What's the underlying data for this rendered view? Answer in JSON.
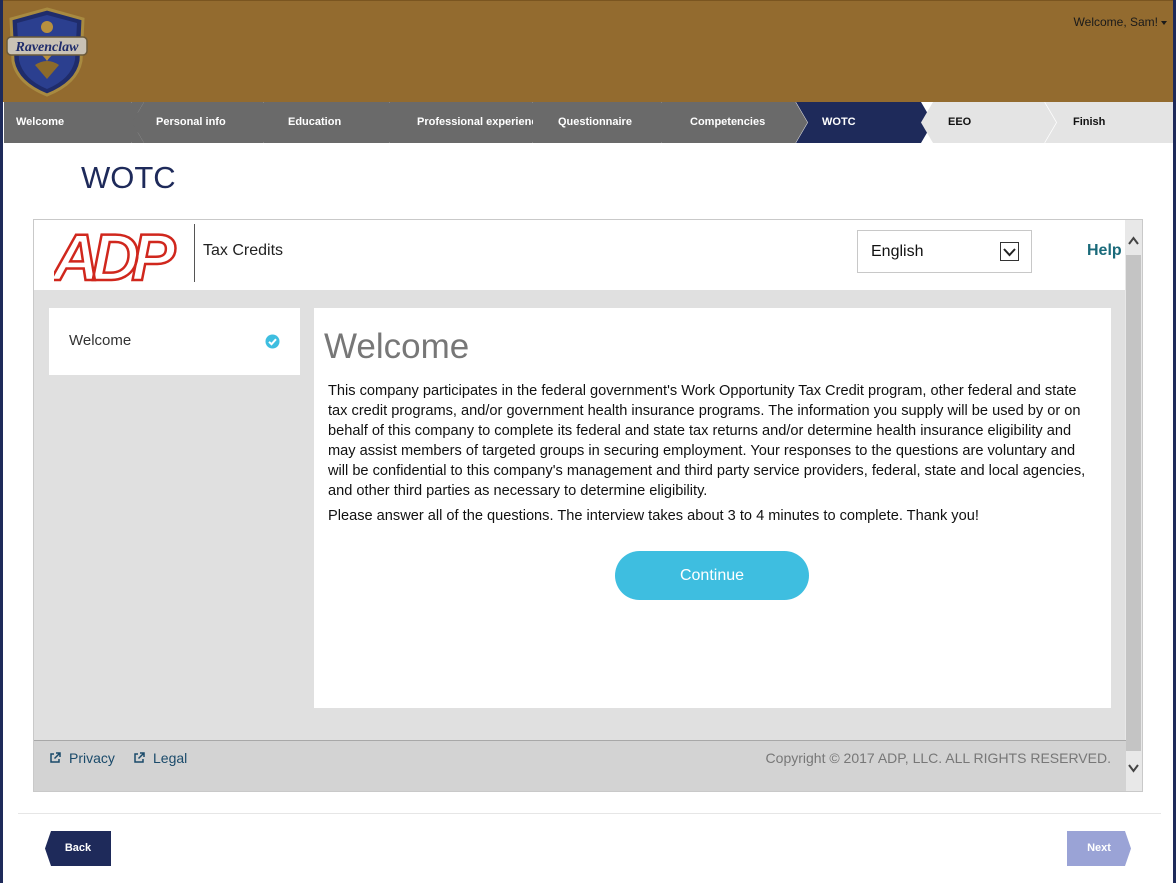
{
  "header": {
    "crest_text": "Ravenclaw",
    "user_menu_label": "Welcome, Sam!"
  },
  "steps": [
    {
      "label": "Welcome",
      "state": "done"
    },
    {
      "label": "Personal info",
      "state": "done"
    },
    {
      "label": "Education",
      "state": "done"
    },
    {
      "label": "Professional experience",
      "state": "done"
    },
    {
      "label": "Questionnaire",
      "state": "done"
    },
    {
      "label": "Competencies",
      "state": "done"
    },
    {
      "label": "WOTC",
      "state": "current"
    },
    {
      "label": "EEO",
      "state": "upcoming"
    },
    {
      "label": "Finish",
      "state": "upcoming"
    }
  ],
  "page_title": "WOTC",
  "adp": {
    "logo_text": "ADP",
    "product_label": "Tax Credits",
    "language": "English",
    "help_label": "Help",
    "side_nav": {
      "label": "Welcome",
      "status_icon": "check-circle-icon"
    },
    "welcome_heading": "Welcome",
    "paragraph_1": "This company participates in the federal government's Work Opportunity Tax Credit program, other federal and state tax credit programs, and/or government health insurance programs. The information you supply will be used by or on behalf of this company to complete its federal and state tax returns and/or determine health insurance eligibility and may assist members of targeted groups in securing employment. Your responses to the questions are voluntary and will be confidential to this company's management and third party service providers, federal, state and local agencies, and other third parties as necessary to determine eligibility.",
    "paragraph_2": "Please answer all of the questions. The interview takes about 3 to 4 minutes to complete. Thank you!",
    "continue_label": "Continue",
    "footer": {
      "privacy_label": "Privacy",
      "legal_label": "Legal",
      "copyright": "Copyright © 2017 ADP, LLC. ALL RIGHTS RESERVED."
    }
  },
  "nav": {
    "back_label": "Back",
    "next_label": "Next"
  },
  "colors": {
    "header_bg": "#936b2f",
    "step_done": "#6a6a6a",
    "step_current": "#1e2a5a",
    "step_upcoming": "#e4e4e4",
    "accent_blue": "#3ebee0",
    "adp_red": "#d0271d",
    "next_disabled": "#9aa3d6"
  }
}
